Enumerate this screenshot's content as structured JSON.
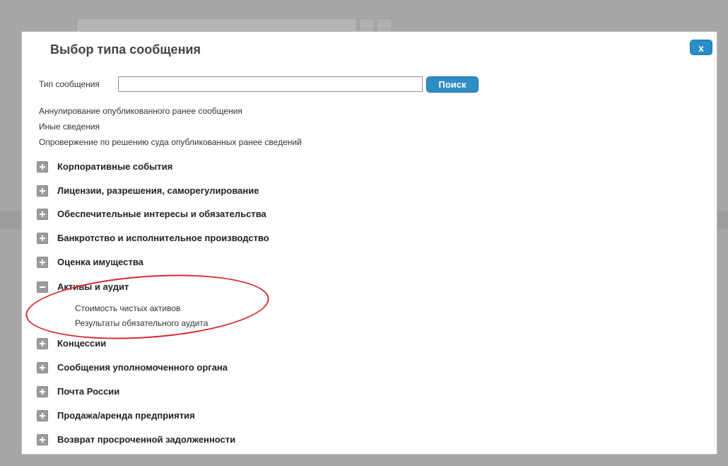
{
  "dialog": {
    "title": "Выбор типа сообщения",
    "close_label": "x"
  },
  "search": {
    "label": "Тип сообщения",
    "value": "",
    "placeholder": "",
    "button_label": "Поиск"
  },
  "plain_items": [
    "Аннулирование опубликованного ранее сообщения",
    "Иные сведения",
    "Опровержение по решению суда опубликованных ранее сведений"
  ],
  "categories": [
    "Корпоративные события",
    "Лицензии, разрешения, саморегулирование",
    "Обеспечительные интересы и обязательства",
    "Банкротство и исполнительное производство",
    "Оценка имущества",
    "Активы и аудит",
    "Концессии",
    "Сообщения уполномоченного органа",
    "Почта России",
    "Продажа/аренда предприятия",
    "Возврат просроченной задолженности"
  ],
  "expanded_category": {
    "index": 5,
    "subitems": [
      "Стоимость чистых активов",
      "Результаты обязательного аудита"
    ]
  },
  "colors": {
    "accent_button": "#2f8dc6",
    "highlight_ellipse": "#d9272e"
  }
}
